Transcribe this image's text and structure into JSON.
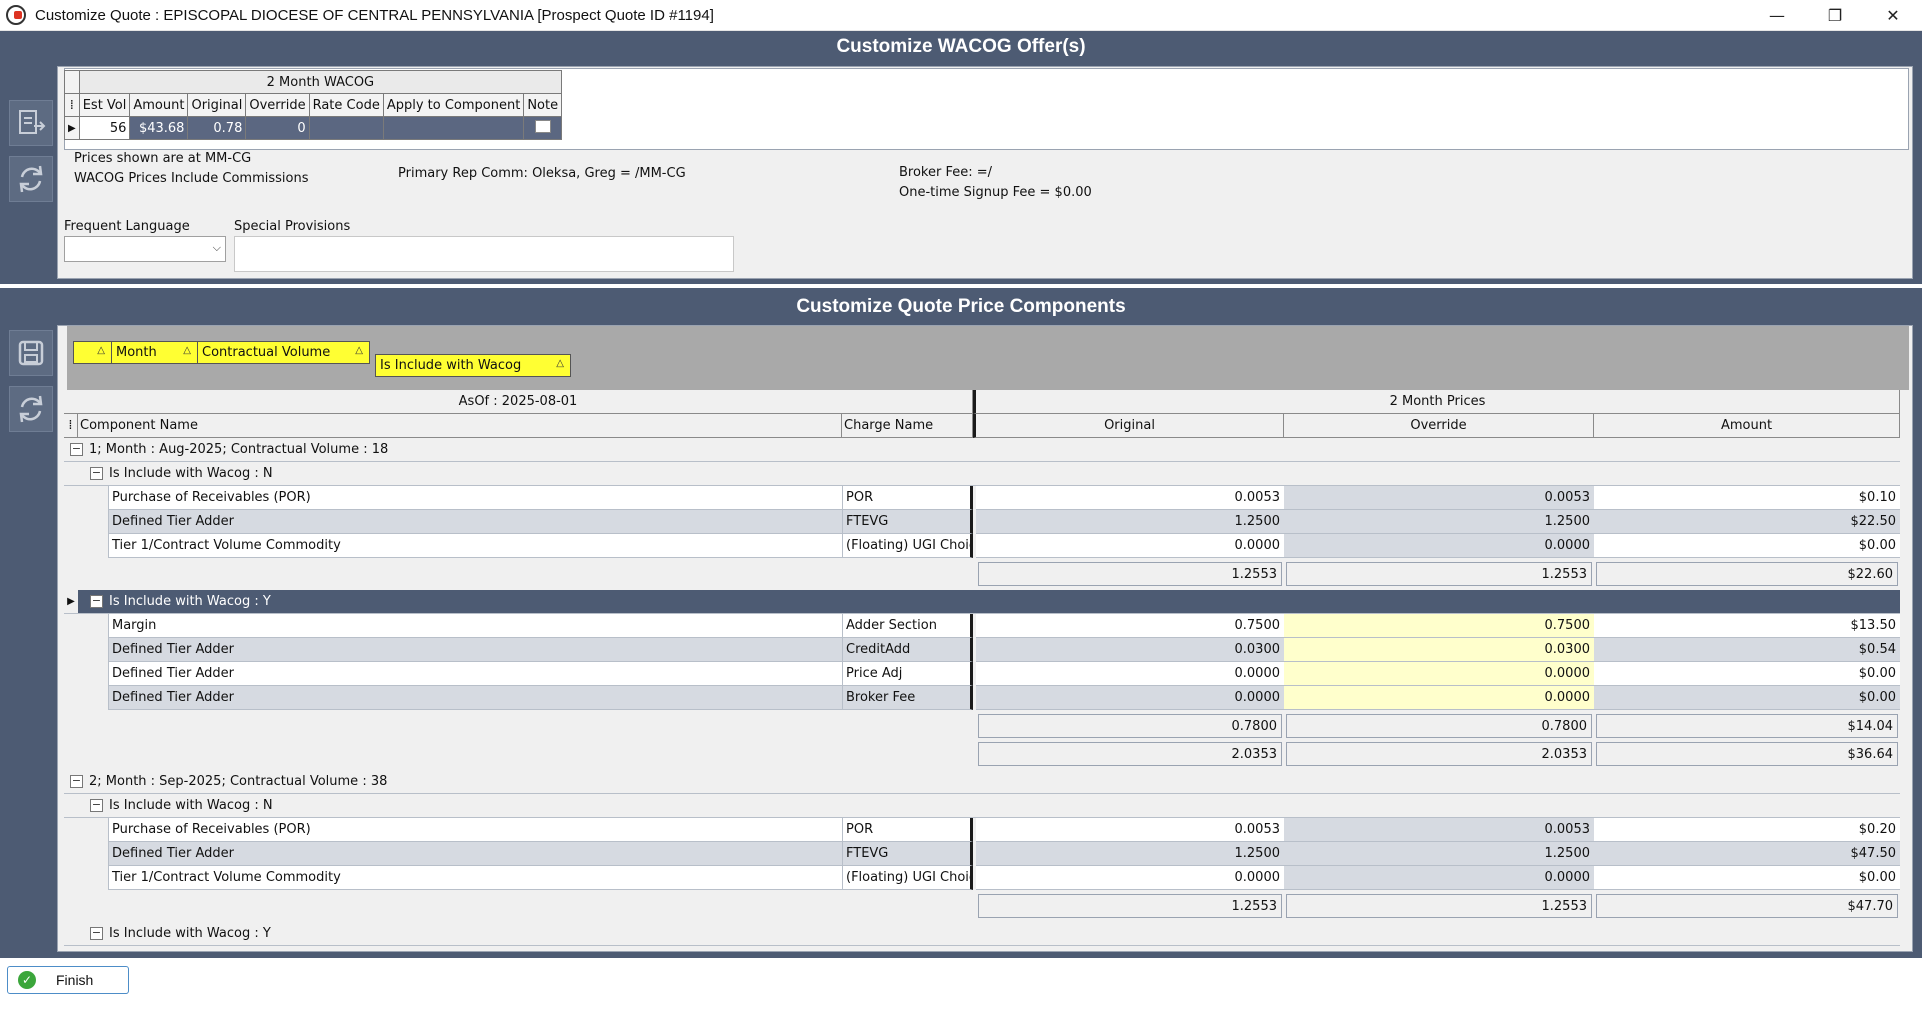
{
  "window": {
    "title": "Customize Quote : EPISCOPAL DIOCESE OF CENTRAL PENNSYLVANIA [Prospect Quote ID #1194]",
    "minimize": "—",
    "restore": "❐",
    "close": "✕"
  },
  "wacog": {
    "heading": "Customize WACOG Offer(s)",
    "group_header": "2 Month WACOG",
    "columns": [
      "Est Vol",
      "Amount",
      "Original",
      "Override",
      "Rate Code",
      "Apply to Component",
      "Note"
    ],
    "row": {
      "est_vol": "56",
      "amount": "$43.68",
      "original": "0.78",
      "override": "0",
      "rate_code": "",
      "apply": ""
    },
    "prices_shown": "Prices shown are at MM-CG",
    "include_commissions": "WACOG Prices Include Commissions",
    "primary_rep": "Primary Rep Comm: Oleksa, Greg =  /MM-CG",
    "broker_fee": "Broker Fee:  =/",
    "signup_fee": "One-time Signup Fee = $0.00",
    "frequent_language_label": "Frequent Language",
    "frequent_language_value": "",
    "special_provisions_label": "Special Provisions",
    "special_provisions_value": ""
  },
  "components": {
    "heading": "Customize Quote Price Components",
    "group_chips": [
      "Month",
      "Contractual Volume",
      "Is Include with Wacog"
    ],
    "asof": "AsOf : 2025-08-01",
    "prices_header": "2 Month Prices",
    "col_component": "Component Name",
    "col_charge": "Charge Name",
    "col_original": "Original",
    "col_override": "Override",
    "col_amount": "Amount",
    "group1": {
      "label": "1; Month : Aug-2025; Contractual Volume : 18",
      "sub_n": {
        "label": "Is Include with Wacog : N",
        "rows": [
          {
            "name": "Purchase of Receivables (POR)",
            "charge": "POR",
            "original": "0.0053",
            "override": "0.0053",
            "amount": "$0.10"
          },
          {
            "name": "Defined Tier Adder",
            "charge": "FTEVG",
            "original": "1.2500",
            "override": "1.2500",
            "amount": "$22.50"
          },
          {
            "name": "Tier 1/Contract Volume Commodity",
            "charge": "(Floating) UGI Choice",
            "original": "0.0000",
            "override": "0.0000",
            "amount": "$0.00"
          }
        ],
        "sum_original": "1.2553",
        "sum_override": "1.2553",
        "sum_amount": "$22.60"
      },
      "sub_y": {
        "label": "Is Include with Wacog : Y",
        "rows": [
          {
            "name": "Margin",
            "charge": "Adder Section",
            "original": "0.7500",
            "override": "0.7500",
            "amount": "$13.50"
          },
          {
            "name": "Defined Tier Adder",
            "charge": "CreditAdd",
            "original": "0.0300",
            "override": "0.0300",
            "amount": "$0.54"
          },
          {
            "name": "Defined Tier Adder",
            "charge": "Price Adj",
            "original": "0.0000",
            "override": "0.0000",
            "amount": "$0.00"
          },
          {
            "name": "Defined Tier Adder",
            "charge": "Broker Fee",
            "original": "0.0000",
            "override": "0.0000",
            "amount": "$0.00"
          }
        ],
        "sum_original": "0.7800",
        "sum_override": "0.7800",
        "sum_amount": "$14.04"
      },
      "total_original": "2.0353",
      "total_override": "2.0353",
      "total_amount": "$36.64"
    },
    "group2": {
      "label": "2; Month : Sep-2025; Contractual Volume : 38",
      "sub_n": {
        "label": "Is Include with Wacog : N",
        "rows": [
          {
            "name": "Purchase of Receivables (POR)",
            "charge": "POR",
            "original": "0.0053",
            "override": "0.0053",
            "amount": "$0.20"
          },
          {
            "name": "Defined Tier Adder",
            "charge": "FTEVG",
            "original": "1.2500",
            "override": "1.2500",
            "amount": "$47.50"
          },
          {
            "name": "Tier 1/Contract Volume Commodity",
            "charge": "(Floating) UGI Choice",
            "original": "0.0000",
            "override": "0.0000",
            "amount": "$0.00"
          }
        ],
        "sum_original": "1.2553",
        "sum_override": "1.2553",
        "sum_amount": "$47.70"
      },
      "sub_y": {
        "label": "Is Include with Wacog : Y"
      }
    }
  },
  "footer": {
    "finish": "Finish"
  },
  "colors": {
    "panel_blue": "#4d5b73",
    "selected_row": "#4d5b73",
    "chip_yellow": "#ffff33",
    "override_yellow": "#ffffcc"
  }
}
